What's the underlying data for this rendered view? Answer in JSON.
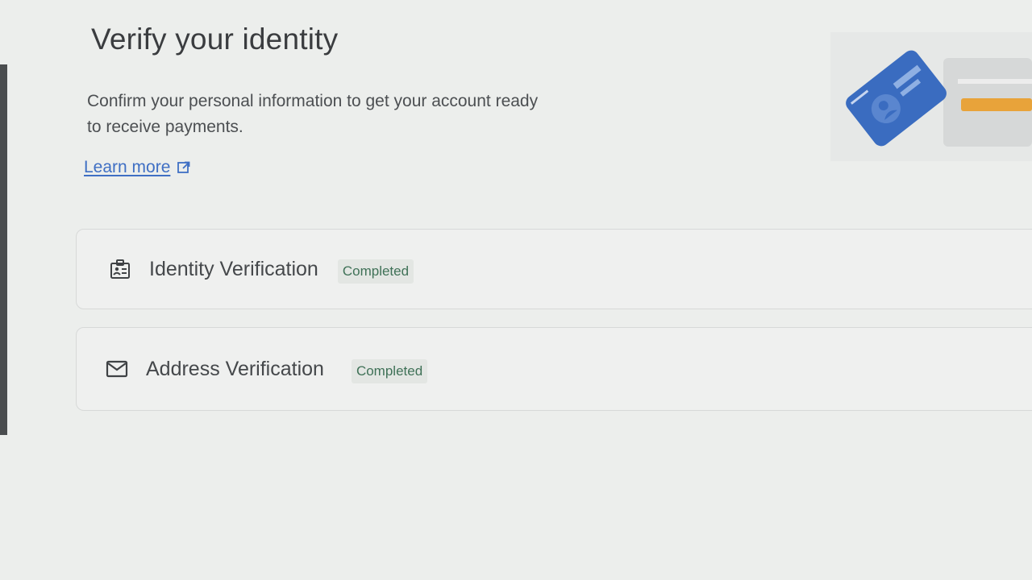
{
  "header": {
    "title": "Verify your identity",
    "description": "Confirm your personal information to get your account ready to receive payments.",
    "learn_more": "Learn more"
  },
  "icons": {
    "learn_more": "open-in-new-icon",
    "identity": "badge-icon",
    "address": "mail-icon",
    "hero": "id-card-illustration"
  },
  "colors": {
    "link": "#3f6fc4",
    "card_accent": "#3a6cc0",
    "status_text": "#3f7157",
    "hero_stripe": "#e8a33a"
  },
  "steps": [
    {
      "title": "Identity Verification",
      "status": "Completed"
    },
    {
      "title": "Address Verification",
      "status": "Completed"
    }
  ]
}
